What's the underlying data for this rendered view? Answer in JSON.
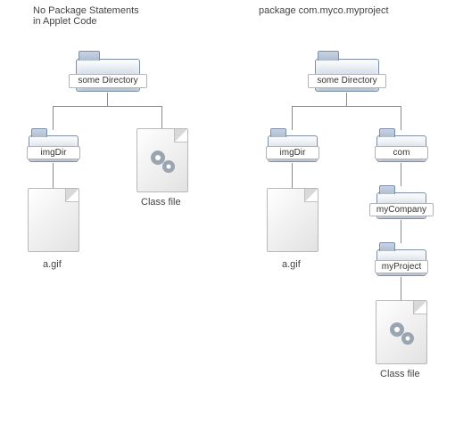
{
  "left": {
    "title": "No Package Statements\nin Applet Code",
    "root": "some Directory",
    "imgDir": "imgDir",
    "classCaption": "Class file",
    "fileName": "a.gif"
  },
  "right": {
    "title": "package com.myco.myproject",
    "root": "some Directory",
    "imgDir": "imgDir",
    "com": "com",
    "myCompany": "myCompany",
    "myProject": "myProject",
    "classCaption": "Class file",
    "fileName": "a.gif"
  }
}
